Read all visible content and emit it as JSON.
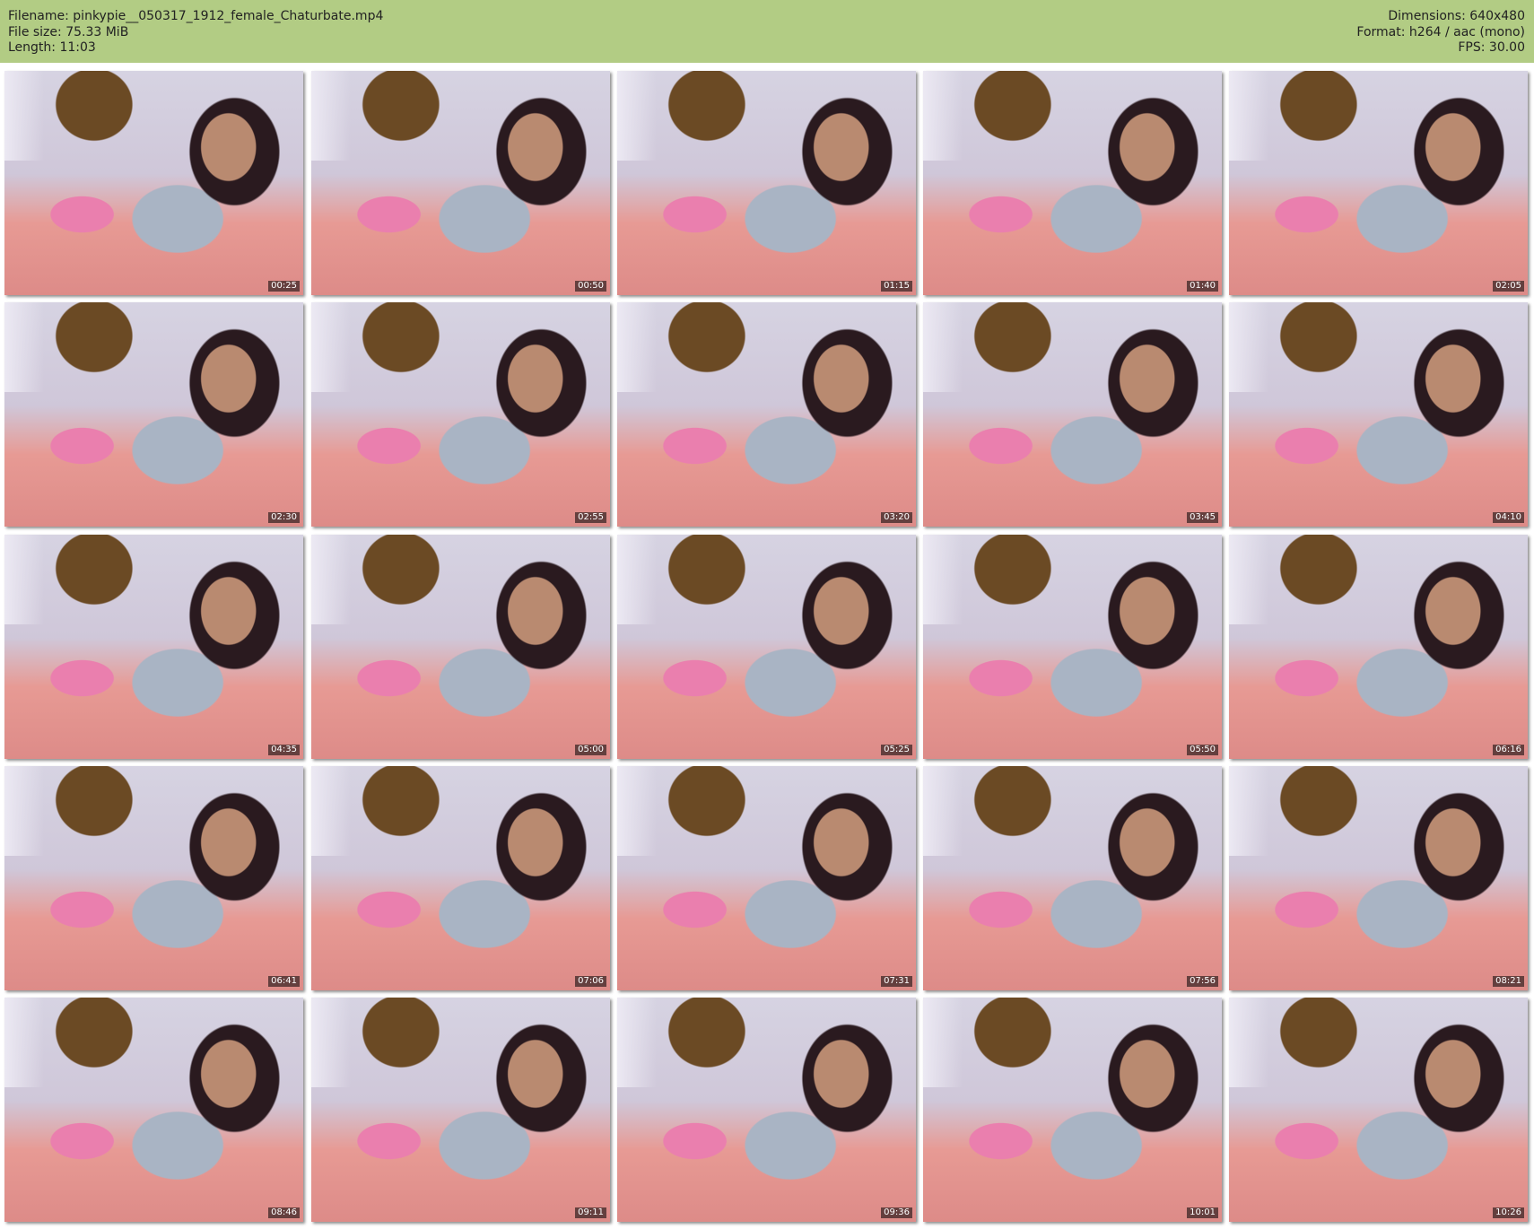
{
  "header": {
    "filename": "Filename: pinkypie__050317_1912_female_Chaturbate.mp4",
    "filesize": "File size: 75.33 MiB",
    "length": "Length: 11:03",
    "dimensions": "Dimensions: 640x480",
    "format": "Format: h264 / aac (mono)",
    "fps": "FPS: 30.00"
  },
  "thumbnails": [
    {
      "timestamp": "00:25"
    },
    {
      "timestamp": "00:50"
    },
    {
      "timestamp": "01:15"
    },
    {
      "timestamp": "01:40"
    },
    {
      "timestamp": "02:05"
    },
    {
      "timestamp": "02:30"
    },
    {
      "timestamp": "02:55"
    },
    {
      "timestamp": "03:20"
    },
    {
      "timestamp": "03:45"
    },
    {
      "timestamp": "04:10"
    },
    {
      "timestamp": "04:35"
    },
    {
      "timestamp": "05:00"
    },
    {
      "timestamp": "05:25"
    },
    {
      "timestamp": "05:50"
    },
    {
      "timestamp": "06:16"
    },
    {
      "timestamp": "06:41"
    },
    {
      "timestamp": "07:06"
    },
    {
      "timestamp": "07:31"
    },
    {
      "timestamp": "07:56"
    },
    {
      "timestamp": "08:21"
    },
    {
      "timestamp": "08:46"
    },
    {
      "timestamp": "09:11"
    },
    {
      "timestamp": "09:36"
    },
    {
      "timestamp": "10:01"
    },
    {
      "timestamp": "10:26"
    }
  ]
}
